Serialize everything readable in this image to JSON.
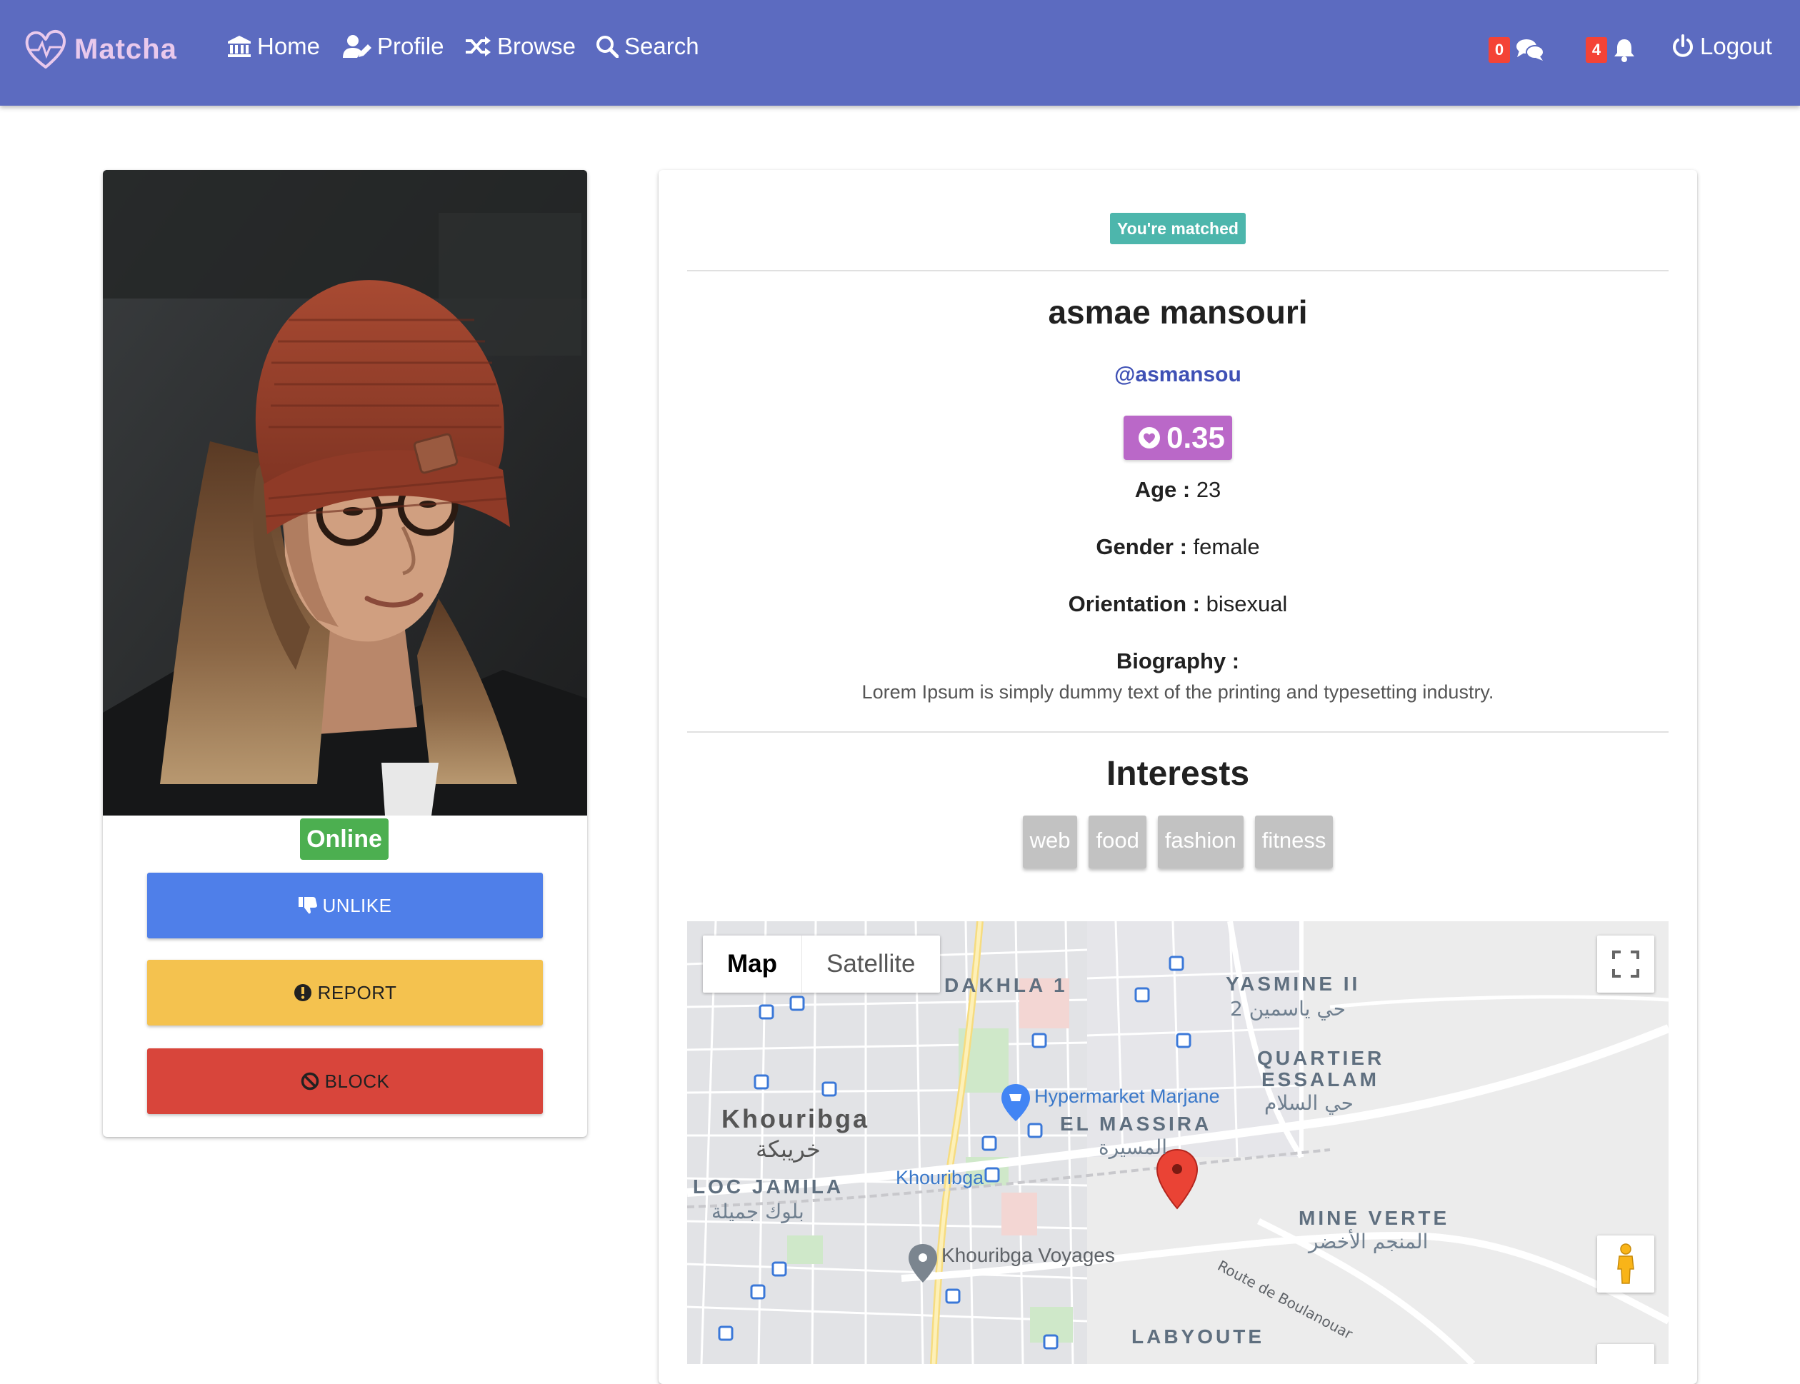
{
  "brand": {
    "name": "Matcha"
  },
  "nav": {
    "home": "Home",
    "profile": "Profile",
    "browse": "Browse",
    "search": "Search",
    "messages_count": "0",
    "notifications_count": "4",
    "logout": "Logout"
  },
  "profile": {
    "status": "Online",
    "actions": {
      "unlike": "UNLIKE",
      "report": "REPORT",
      "block": "BLOCK"
    },
    "matched_badge": "You're matched",
    "full_name": "asmae mansouri",
    "username": "@asmansou",
    "score": "0.35",
    "age_label": "Age :",
    "age": "23",
    "gender_label": "Gender :",
    "gender": "female",
    "orientation_label": "Orientation :",
    "orientation": "bisexual",
    "biography_label": "Biography :",
    "biography": "Lorem Ipsum is simply dummy text of the printing and typesetting industry.",
    "interests_title": "Interests",
    "interests": [
      "web",
      "food",
      "fashion",
      "fitness"
    ]
  },
  "map": {
    "type_map": "Map",
    "type_satellite": "Satellite",
    "labels": {
      "dakhla": "DAKHLA 1",
      "yasmine": "YASMINE II",
      "yasmine_ar": "حي ياسمين 2",
      "quartier1": "QUARTIER",
      "quartier2": "ESSALAM",
      "quartier_ar": "حي السلام",
      "hypermarket": "Hypermarket Marjane",
      "khouribga": "Khouribga",
      "khouribga_ar": "خريبكة",
      "el_massira": "EL MASSIRA",
      "el_massira_ar": "المسيرة",
      "loc_jamila": "LOC JAMILA",
      "loc_jamila_ar": "بلوك جميلة",
      "khouribga_station": "Khouribga",
      "mine_verte": "MINE VERTE",
      "mine_verte_ar": "المنجم الأخضر",
      "route": "Route de Boulanouar",
      "voyages": "Khouribga Voyages",
      "labyoute": "LABYOUTE"
    }
  },
  "colors": {
    "navbar": "#5c6bc0",
    "unlike": "#4f7fe9",
    "report": "#f4c24f",
    "block": "#d8453b",
    "online": "#4caf50",
    "matched": "#4db6ac",
    "score": "#ba68c8",
    "username": "#3f51b5",
    "badge": "#f44336"
  },
  "icons": {
    "logo": "heart-outline-icon",
    "home": "bank-icon",
    "profile": "user-edit-icon",
    "browse": "random-icon",
    "search": "search-icon",
    "messages": "comments-icon",
    "notifications": "bell-icon",
    "logout": "power-icon",
    "unlike": "thumbs-down-icon",
    "report": "exclamation-circle-icon",
    "block": "ban-icon",
    "score": "heart-circle-icon",
    "fullscreen": "fullscreen-icon",
    "pegman": "pegman-icon",
    "marker": "map-marker-icon"
  }
}
